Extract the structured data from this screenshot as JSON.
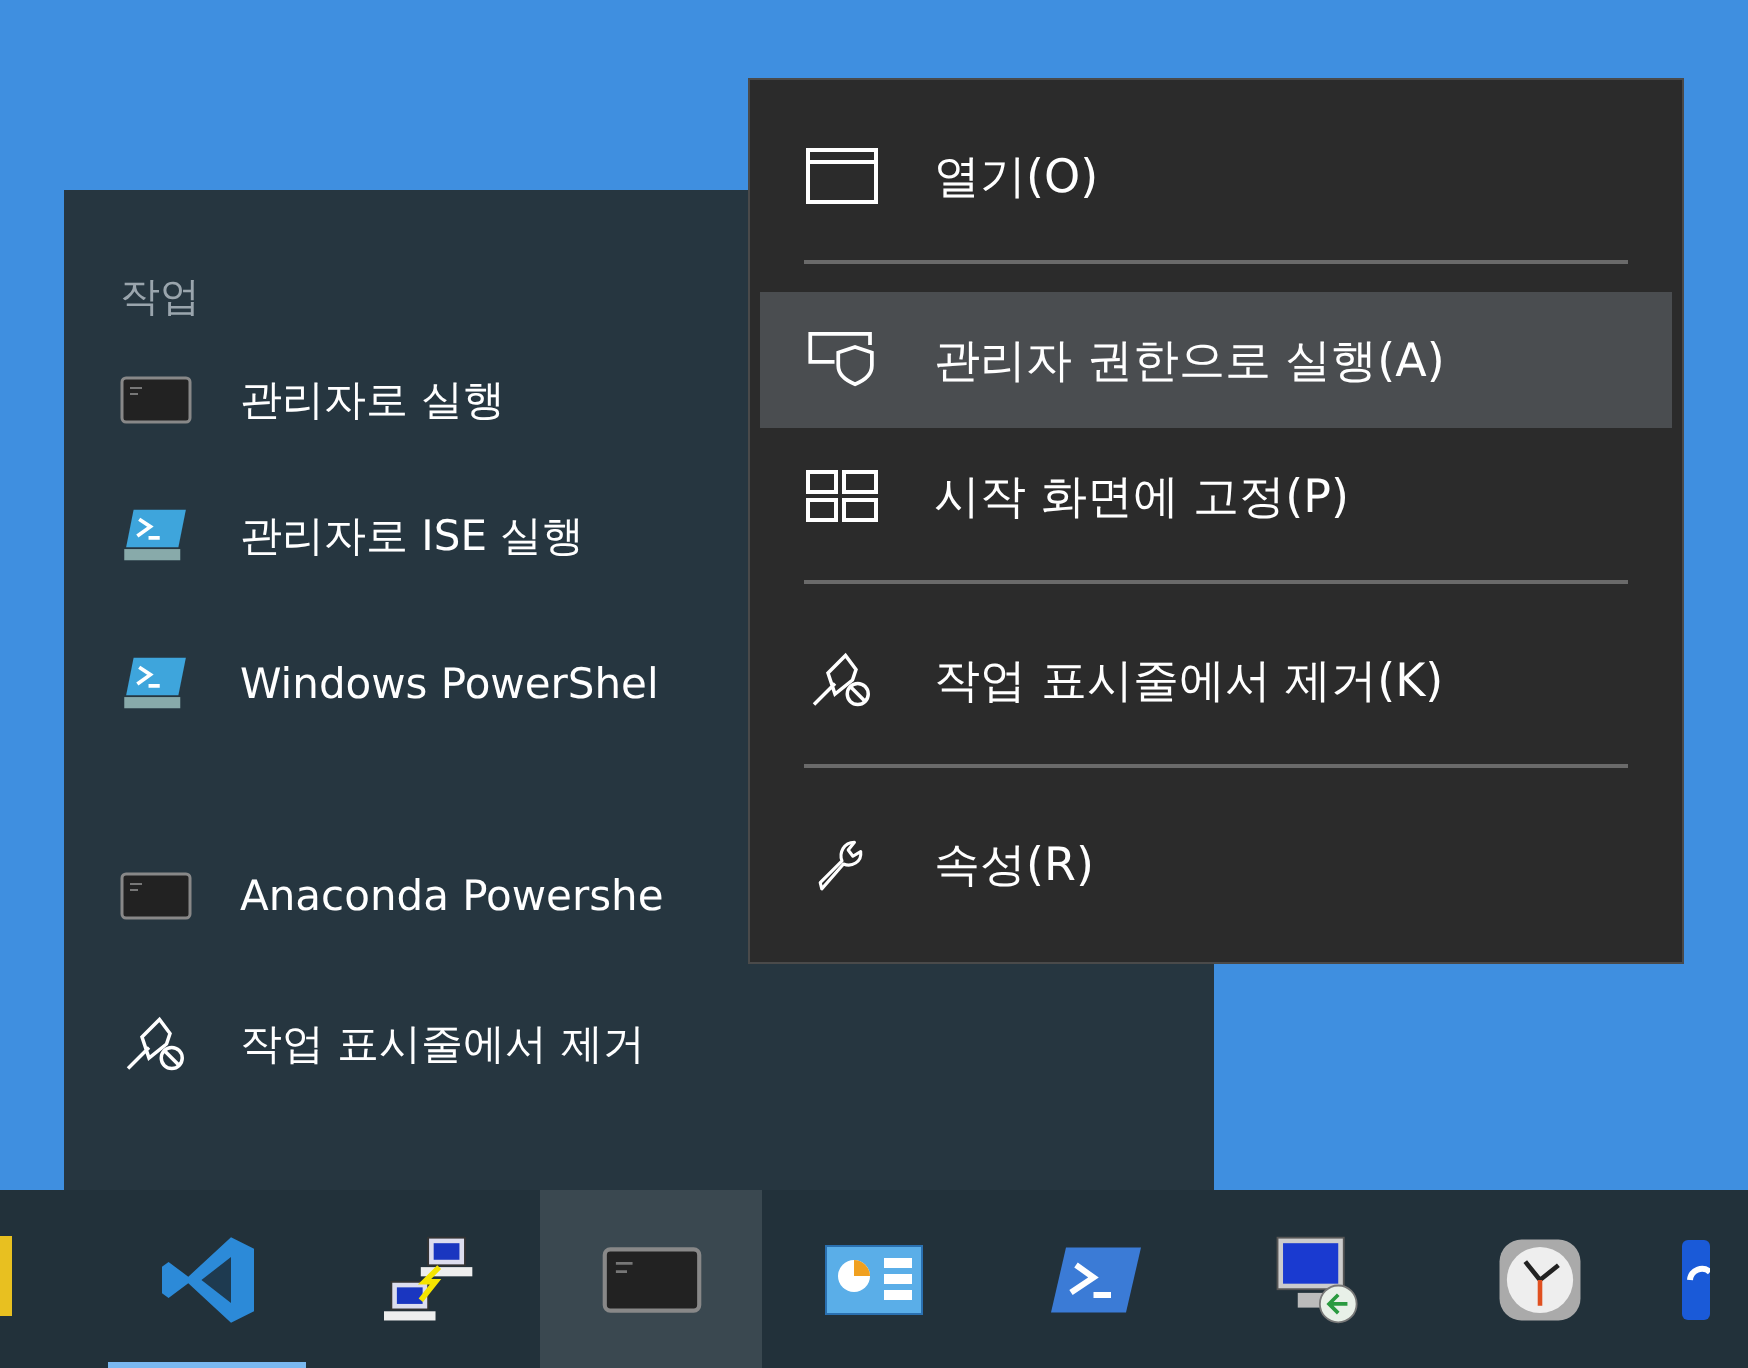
{
  "jump_list": {
    "heading": "작업",
    "items": [
      {
        "kind": "terminal",
        "label": "관리자로 실행"
      },
      {
        "kind": "powershell",
        "label": "관리자로 ISE 실행"
      },
      {
        "kind": "powershell",
        "label": "Windows PowerShel"
      },
      {
        "kind": "terminal",
        "label": "Anaconda Powershe",
        "gap_before": true
      },
      {
        "kind": "unpin",
        "label": "작업 표시줄에서 제거"
      }
    ]
  },
  "context_menu": {
    "items": [
      {
        "kind": "window",
        "label": "열기(O)",
        "selected": false,
        "separator_after": true
      },
      {
        "kind": "shield",
        "label": "관리자 권한으로 실행(A)",
        "selected": true,
        "separator_after": false
      },
      {
        "kind": "tiles",
        "label": "시작 화면에 고정(P)",
        "selected": false,
        "separator_after": true
      },
      {
        "kind": "unpin",
        "label": "작업 표시줄에서 제거(K)",
        "selected": false,
        "separator_after": true
      },
      {
        "kind": "wrench",
        "label": "속성(R)",
        "selected": false,
        "separator_after": false
      }
    ]
  },
  "taskbar": {
    "items": [
      {
        "kind": "ribbon",
        "selected": false,
        "running": true
      },
      {
        "kind": "network",
        "selected": false,
        "running": false
      },
      {
        "kind": "terminal",
        "selected": true,
        "running": false
      },
      {
        "kind": "dashboard",
        "selected": false,
        "running": false
      },
      {
        "kind": "powershell",
        "selected": false,
        "running": false
      },
      {
        "kind": "remote",
        "selected": false,
        "running": false
      },
      {
        "kind": "clock",
        "selected": false,
        "running": false
      },
      {
        "kind": "partial",
        "selected": false,
        "running": false
      }
    ]
  }
}
